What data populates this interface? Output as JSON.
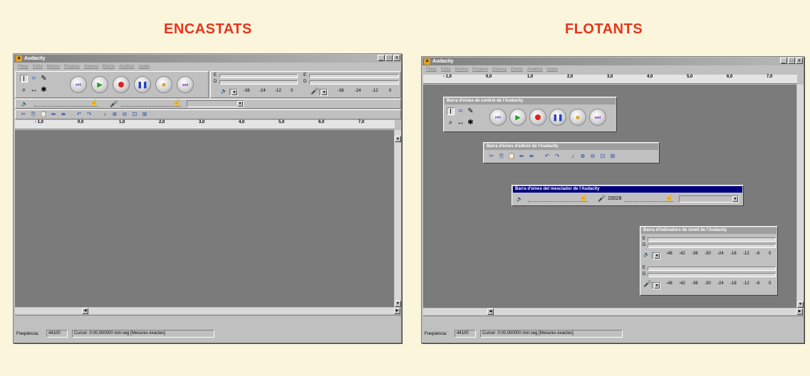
{
  "headings": {
    "left": "ENCASTATS",
    "right": "FLOTANTS"
  },
  "app": {
    "title": "Audacity",
    "window_buttons": [
      "_",
      "□",
      "x"
    ],
    "menu": [
      "Fitxer",
      "Edita",
      "Mostra",
      "Projecte",
      "Genera",
      "Efecte",
      "Analitza",
      "Ajuda"
    ]
  },
  "tools": {
    "row1": [
      "I",
      "≈",
      "✎"
    ],
    "row2": [
      "⌕",
      "↔",
      "✱"
    ]
  },
  "transport": [
    "skip-start",
    "play",
    "record",
    "pause",
    "stop",
    "skip-end"
  ],
  "meter": {
    "scale_embedded": [
      "-36",
      "-24",
      "-12",
      "0"
    ],
    "scale_floating": [
      "-48",
      "-42",
      "-36",
      "-30",
      "-24",
      "-18",
      "-12",
      "-6",
      "0"
    ],
    "channel_labels": [
      "E",
      "D"
    ]
  },
  "mixer": {
    "volume_icon": "🔈",
    "input_icon": "🎤",
    "source_value": "15028"
  },
  "ruler_ticks": [
    "- 1,0",
    "0,0",
    "1,0",
    "2,0",
    "3,0",
    "4,0",
    "5,0",
    "6,0",
    "7,0"
  ],
  "floating_titles": {
    "control": "Barra d'eines de control de l'Audacity",
    "edit": "Barra d'eines d'edició de l'Audacity",
    "mixer": "Barra d'eines del mesclador de l'Audacity",
    "meter": "Barra d'indicadors de nivell de l'Audacity"
  },
  "status": {
    "freq_label": "Freqüència:",
    "freq_value": "44100",
    "cursor_text": "Cursor: 0:00,000000 min:seg",
    "mode_text": "[Mesures exactes]"
  },
  "colors": {
    "heading": "#e8341c",
    "canvas": "#7b7b7b",
    "active_title": "#00007f"
  }
}
